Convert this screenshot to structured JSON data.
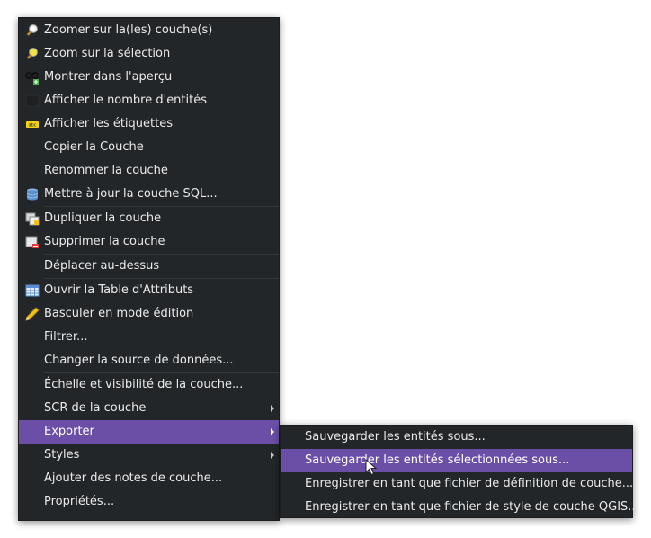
{
  "menu": {
    "items": [
      {
        "label": "Zoomer sur la(les) couche(s)",
        "icon": "zoom-layer-icon"
      },
      {
        "label": "Zoom sur la sélection",
        "icon": "zoom-selection-icon"
      },
      {
        "label": "Montrer dans l'aperçu",
        "icon": "overview-icon"
      },
      {
        "label": "Afficher le nombre d'entités",
        "icon": "feature-count-icon"
      },
      {
        "label": "Afficher les étiquettes",
        "icon": "labels-icon"
      },
      {
        "label": "Copier la Couche"
      },
      {
        "label": "Renommer la couche"
      },
      {
        "label": "Mettre à jour la couche SQL...",
        "icon": "database-icon"
      },
      {
        "label": "Dupliquer la couche",
        "icon": "duplicate-layer-icon"
      },
      {
        "label": "Supprimer la couche",
        "icon": "remove-layer-icon"
      },
      {
        "label": "Déplacer au-dessus"
      },
      {
        "label": "Ouvrir la Table d'Attributs",
        "icon": "attribute-table-icon"
      },
      {
        "label": "Basculer en mode édition",
        "icon": "pencil-icon"
      },
      {
        "label": "Filtrer..."
      },
      {
        "label": "Changer la source de données..."
      },
      {
        "label": "Échelle et visibilité de la couche..."
      },
      {
        "label": "SCR de la couche",
        "submenu": true
      },
      {
        "label": "Exporter",
        "submenu": true,
        "selected": true
      },
      {
        "label": "Styles",
        "submenu": true
      },
      {
        "label": "Ajouter des notes de couche..."
      },
      {
        "label": "Propriétés..."
      }
    ]
  },
  "export_submenu": {
    "items": [
      {
        "label": "Sauvegarder les entités sous..."
      },
      {
        "label": "Sauvegarder les entités sélectionnées sous...",
        "selected": true
      },
      {
        "label": "Enregistrer en tant que fichier de définition de couche..."
      },
      {
        "label": "Enregistrer en tant que fichier de style de couche QGIS..."
      }
    ]
  },
  "colors": {
    "menu_background": "#232629",
    "selection": "#6b4fa7",
    "text": "#eaeaea"
  }
}
